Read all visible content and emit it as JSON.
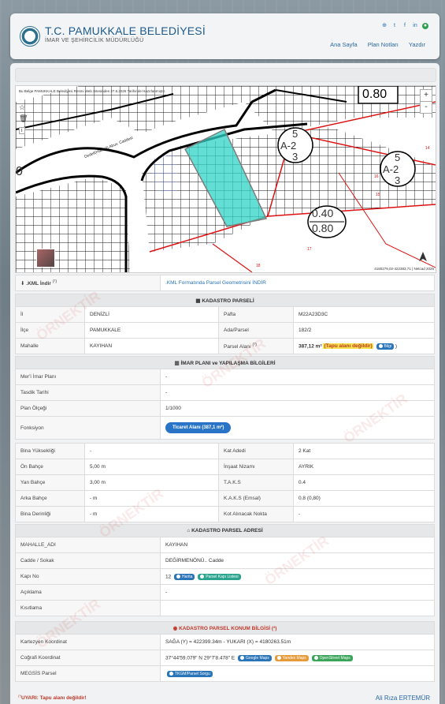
{
  "header": {
    "title": "T.C. PAMUKKALE BELEDİYESİ",
    "subtitle": "İMAR VE ŞEHİRCİLİK MÜDÜRLÜĞÜ",
    "nav": [
      "Ana Sayfa",
      "Plan Notları",
      "Yazdır"
    ],
    "social_icons": [
      "globe-icon",
      "twitter-icon",
      "facebook-icon",
      "linkedin-icon",
      "user-icon"
    ]
  },
  "map": {
    "note": "Bu Belge PAMUKKALE Belediyesi Resmi Web Sitesinden 27.6.2026 Tarihinde Hazırlanmıştır.",
    "coord": "4180279,02-422383,71 | Netcad 2026",
    "zoom_in": "+",
    "zoom_out": "-",
    "labels": {
      "ratio_top": "0.80",
      "ratio1": "0.40",
      "ratio2": "0.80",
      "zone_a": "5",
      "zone_a2": "A-2",
      "zone_a3": "3",
      "zone_b": "5",
      "zone_b2": "A-2",
      "zone_b3": "3",
      "left_zero": "0",
      "street": "Dedeli(Hacıali) Abuv. Caddesi",
      "n14": "14",
      "n15": "15",
      "n16": "16",
      "n17": "17",
      "n18": "18"
    }
  },
  "kml": {
    "label": ".KML İndir",
    "sup": "(¹)",
    "link": ".KML Formatında Parsel Geometrisini İNDİR"
  },
  "kadastro": {
    "title": "KADASTRO PARSELİ",
    "rows": [
      {
        "l1": "İl",
        "v1": "DENİZLİ",
        "l2": "Pafta",
        "v2": "M22A23D3C"
      },
      {
        "l1": "İlçe",
        "v1": "PAMUKKALE",
        "l2": "Ada/Parsel",
        "v2": "182/2"
      },
      {
        "l1": "Mahalle",
        "v1": "KAYIHAN",
        "l2": "Parsel Alanı",
        "v2": "387,12 m²"
      }
    ],
    "parsel_sup": "(¹)",
    "tapu_text": "(Tapu alanı değildir)",
    "bilgi": "Bilgi",
    "close_paren": ")"
  },
  "imar": {
    "title": "İMAR PLANI ve YAPILAŞMA BİLGİLERİ",
    "rows": [
      {
        "l": "Mer'i İmar Planı",
        "v": "-"
      },
      {
        "l": "Tasdik Tarihi",
        "v": "-"
      },
      {
        "l": "Plan Ölçeği",
        "v": "1/1000"
      }
    ],
    "fonksiyon_label": "Fonksiyon",
    "fonksiyon_value": "Ticaret Alanı (387,1 m²)",
    "pairs": [
      {
        "l1": "Bina Yüksekliği",
        "v1": "-",
        "l2": "Kat Adedi",
        "v2": "2 Kat"
      },
      {
        "l1": "Ön Bahçe",
        "v1": "5,00 m",
        "l2": "İnşaat Nizamı",
        "v2": "AYRIK"
      },
      {
        "l1": "Yan Bahçe",
        "v1": "3,00 m",
        "l2": "T.A.K.S",
        "v2": "0.4"
      },
      {
        "l1": "Arka Bahçe",
        "v1": "- m",
        "l2": "K.A.K.S (Emsal)",
        "v2": "0.8 (0,80)"
      },
      {
        "l1": "Bina Derinliği",
        "v1": "- m",
        "l2": "Kot Alınacak Nokta",
        "v2": "-"
      }
    ]
  },
  "adres": {
    "title": "KADASTRO PARSEL ADRESİ",
    "rows": [
      {
        "l": "MAHALLE_ADI",
        "v": "KAYIHAN"
      },
      {
        "l": "Cadde / Sokak",
        "v": "DEĞİRMENÖNÜ.. Cadde"
      }
    ],
    "kapi_label": "Kapı No",
    "kapi_value": "12",
    "harita_btn": "Harita",
    "parsel_kapi_btn": "Parsel Kapı Listesi",
    "aciklama_label": "Açıklama",
    "aciklama_value": "-",
    "kisitlama_label": "Kısıtlama",
    "kisitlama_value": ""
  },
  "konum": {
    "title": "KADASTRO PARSEL KONUM BİLGİSİ (²)",
    "kartezyen_label": "Kartezyen Koordinat",
    "kartezyen_value": "SAĞA (Y) = 422399.34m - YUKARI (X) = 4180263.51m",
    "cografi_label": "Coğrafi Koordinat",
    "cografi_value": "37°44'59.079\" N 29°7'8.478\" E",
    "google_btn": "Google Maps",
    "yandex_btn": "Yandex Maps",
    "osm_btn": "OpenStreet Maps",
    "megsis_label": "MEGSİS Parsel",
    "megsis_btn": "TKGM/Parsel Sorgu"
  },
  "footer": {
    "warn_sup": "(¹)",
    "warn": "UYARI: Tapu alanı değildir!",
    "name": "Ali Rıza ERTEMÜR"
  },
  "watermark": "ÖRNEKTİR",
  "colors": {
    "accent": "#2a74b8",
    "alert": "#c0392b",
    "parcel": "#2fd3c6"
  }
}
